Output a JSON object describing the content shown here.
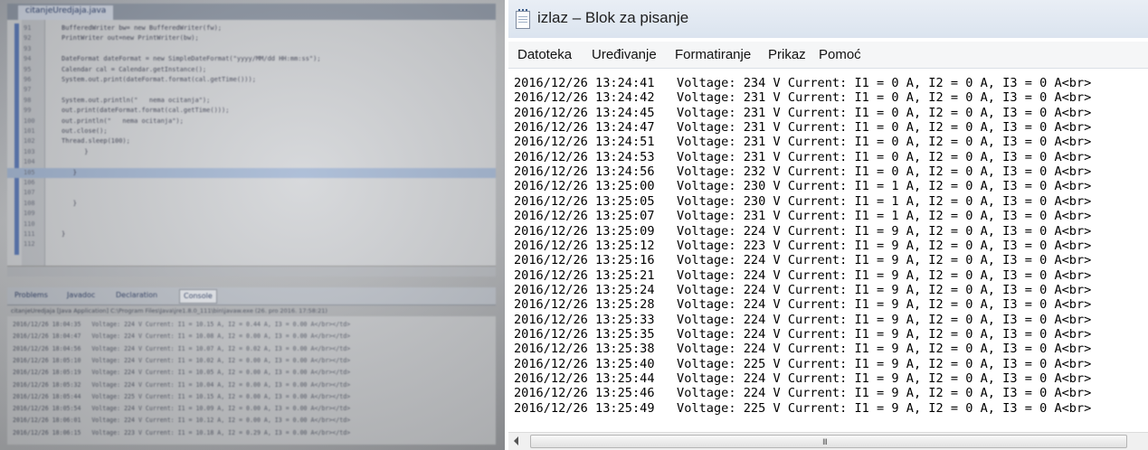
{
  "ide": {
    "tab_label": "citanjeUredjaja.java",
    "code_lines": [
      {
        "ln": "91",
        "text": "BufferedWriter bw= new BufferedWriter(fw);"
      },
      {
        "ln": "92",
        "text": "PrintWriter out=new PrintWriter(bw);"
      },
      {
        "ln": "93",
        "text": ""
      },
      {
        "ln": "94",
        "text": "DateFormat dateFormat = new SimpleDateFormat(\"yyyy/MM/dd HH:mm:ss\");"
      },
      {
        "ln": "95",
        "text": "Calendar cal = Calendar.getInstance();"
      },
      {
        "ln": "96",
        "text": "System.out.print(dateFormat.format(cal.getTime()));"
      },
      {
        "ln": "97",
        "text": ""
      },
      {
        "ln": "98",
        "text": "System.out.println(\"   nema ocitanja\");"
      },
      {
        "ln": "99",
        "text": "out.print(dateFormat.format(cal.getTime()));"
      },
      {
        "ln": "100",
        "text": "out.println(\"   nema ocitanja\");"
      },
      {
        "ln": "101",
        "text": "out.close();"
      },
      {
        "ln": "102",
        "text": "Thread.sleep(100);"
      },
      {
        "ln": "103",
        "text": "      }"
      },
      {
        "ln": "104",
        "text": ""
      },
      {
        "ln": "105",
        "text": "   }"
      },
      {
        "ln": "106",
        "text": ""
      },
      {
        "ln": "107",
        "text": ""
      },
      {
        "ln": "108",
        "text": "   }"
      },
      {
        "ln": "109",
        "text": ""
      },
      {
        "ln": "110",
        "text": ""
      },
      {
        "ln": "111",
        "text": "}"
      },
      {
        "ln": "112",
        "text": ""
      }
    ],
    "console_tabs": [
      "Problems",
      "Javadoc",
      "Declaration",
      "Console"
    ],
    "console_header": "citanjeUredjaja [Java Application] C:\\Program Files\\Java\\jre1.8.0_111\\bin\\javaw.exe (26. pro 2016. 17:58:21)",
    "console_lines": [
      "2016/12/26 18:04:35   Voltage: 224 V Current: I1 = 10.15 A, I2 = 0.44 A, I3 = 0.00 A</br></td>",
      "2016/12/26 18:04:47   Voltage: 224 V Current: I1 = 10.08 A, I2 = 0.00 A, I3 = 0.00 A</br></td>",
      "2016/12/26 18:04:56   Voltage: 224 V Current: I1 = 10.07 A, I2 = 0.02 A, I3 = 0.00 A</br></td>",
      "2016/12/26 18:05:10   Voltage: 224 V Current: I1 = 10.02 A, I2 = 0.00 A, I3 = 0.00 A</br></td>",
      "2016/12/26 18:05:19   Voltage: 224 V Current: I1 = 10.05 A, I2 = 0.00 A, I3 = 0.00 A</br></td>",
      "2016/12/26 18:05:32   Voltage: 224 V Current: I1 = 10.04 A, I2 = 0.00 A, I3 = 0.00 A</br></td>",
      "2016/12/26 18:05:44   Voltage: 225 V Current: I1 = 10.15 A, I2 = 0.00 A, I3 = 0.00 A</br></td>",
      "2016/12/26 18:05:54   Voltage: 224 V Current: I1 = 10.09 A, I2 = 0.00 A, I3 = 0.00 A</br></td>",
      "2016/12/26 18:06:01   Voltage: 224 V Current: I1 = 10.12 A, I2 = 0.00 A, I3 = 0.00 A</br></td>",
      "2016/12/26 18:06:15   Voltage: 223 V Current: I1 = 10.18 A, I2 = 0.29 A, I3 = 0.00 A</br></td>"
    ]
  },
  "notepad": {
    "title": "izlaz – Blok za pisanje",
    "menu": [
      "Datoteka",
      "Uređivanje",
      "Formatiranje",
      "Prikaz",
      "Pomoć"
    ],
    "lines": [
      "2016/12/26 13:24:41   Voltage: 234 V Current: I1 = 0 A, I2 = 0 A, I3 = 0 A<br>",
      "2016/12/26 13:24:42   Voltage: 231 V Current: I1 = 0 A, I2 = 0 A, I3 = 0 A<br>",
      "2016/12/26 13:24:45   Voltage: 231 V Current: I1 = 0 A, I2 = 0 A, I3 = 0 A<br>",
      "2016/12/26 13:24:47   Voltage: 231 V Current: I1 = 0 A, I2 = 0 A, I3 = 0 A<br>",
      "2016/12/26 13:24:51   Voltage: 231 V Current: I1 = 0 A, I2 = 0 A, I3 = 0 A<br>",
      "2016/12/26 13:24:53   Voltage: 231 V Current: I1 = 0 A, I2 = 0 A, I3 = 0 A<br>",
      "2016/12/26 13:24:56   Voltage: 232 V Current: I1 = 0 A, I2 = 0 A, I3 = 0 A<br>",
      "2016/12/26 13:25:00   Voltage: 230 V Current: I1 = 1 A, I2 = 0 A, I3 = 0 A<br>",
      "2016/12/26 13:25:05   Voltage: 230 V Current: I1 = 1 A, I2 = 0 A, I3 = 0 A<br>",
      "2016/12/26 13:25:07   Voltage: 231 V Current: I1 = 1 A, I2 = 0 A, I3 = 0 A<br>",
      "2016/12/26 13:25:09   Voltage: 224 V Current: I1 = 9 A, I2 = 0 A, I3 = 0 A<br>",
      "2016/12/26 13:25:12   Voltage: 223 V Current: I1 = 9 A, I2 = 0 A, I3 = 0 A<br>",
      "2016/12/26 13:25:16   Voltage: 224 V Current: I1 = 9 A, I2 = 0 A, I3 = 0 A<br>",
      "2016/12/26 13:25:21   Voltage: 224 V Current: I1 = 9 A, I2 = 0 A, I3 = 0 A<br>",
      "2016/12/26 13:25:24   Voltage: 224 V Current: I1 = 9 A, I2 = 0 A, I3 = 0 A<br>",
      "2016/12/26 13:25:28   Voltage: 224 V Current: I1 = 9 A, I2 = 0 A, I3 = 0 A<br>",
      "2016/12/26 13:25:33   Voltage: 224 V Current: I1 = 9 A, I2 = 0 A, I3 = 0 A<br>",
      "2016/12/26 13:25:35   Voltage: 224 V Current: I1 = 9 A, I2 = 0 A, I3 = 0 A<br>",
      "2016/12/26 13:25:38   Voltage: 224 V Current: I1 = 9 A, I2 = 0 A, I3 = 0 A<br>",
      "2016/12/26 13:25:40   Voltage: 225 V Current: I1 = 9 A, I2 = 0 A, I3 = 0 A<br>",
      "2016/12/26 13:25:44   Voltage: 224 V Current: I1 = 9 A, I2 = 0 A, I3 = 0 A<br>",
      "2016/12/26 13:25:46   Voltage: 224 V Current: I1 = 9 A, I2 = 0 A, I3 = 0 A<br>",
      "2016/12/26 13:25:49   Voltage: 225 V Current: I1 = 9 A, I2 = 0 A, I3 = 0 A<br>"
    ],
    "scroll_grip": "III"
  },
  "icons": {
    "notepad": "notepad-icon",
    "scroll_left": "arrow-left-icon"
  },
  "colors": {
    "ide_highlight": "#a4b7d3",
    "ide_string": "#2e4bd6",
    "notepad_title_bg": "#dbe4ef"
  }
}
